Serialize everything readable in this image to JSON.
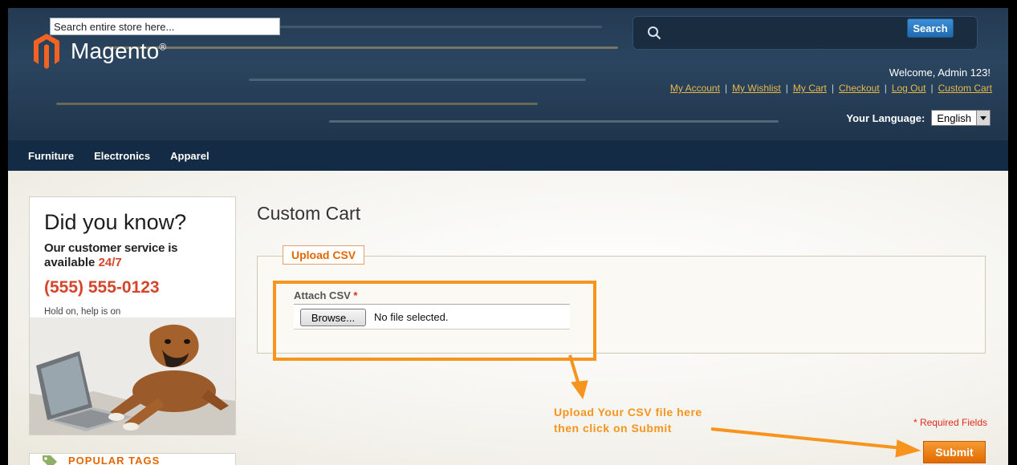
{
  "brand": {
    "name": "Magento",
    "mark": "®"
  },
  "search": {
    "placeholder": "Search entire store here...",
    "button_label": "Search"
  },
  "account": {
    "welcome": "Welcome, Admin 123!",
    "links": [
      "My Account",
      "My Wishlist",
      "My Cart",
      "Checkout",
      "Log Out",
      "Custom Cart"
    ],
    "separator": "|"
  },
  "language": {
    "label": "Your Language:",
    "selected": "English"
  },
  "nav": {
    "items": [
      "Furniture",
      "Electronics",
      "Apparel"
    ]
  },
  "promo": {
    "title": "Did you know?",
    "line1": "Our customer service is",
    "line2": "available",
    "line2_highlight": "24/7",
    "phone": "(555) 555-0123",
    "hold": "Hold on, help is on the way."
  },
  "sidebar": {
    "tags_title": "POPULAR TAGS"
  },
  "main": {
    "title": "Custom Cart",
    "legend": "Upload CSV",
    "attach_label": "Attach CSV",
    "required_mark": "*",
    "browse_label": "Browse...",
    "file_status": "No file selected.",
    "required_fields": "* Required Fields",
    "submit_label": "Submit"
  },
  "annotation": {
    "line1": "Upload Your CSV file here",
    "line2": "then click on Submit"
  },
  "colors": {
    "header": "#243a52",
    "nav": "#132b44",
    "accent_orange": "#f7941d",
    "link": "#e8b84a",
    "required": "#e02b1a",
    "promo_red": "#d6452a"
  }
}
